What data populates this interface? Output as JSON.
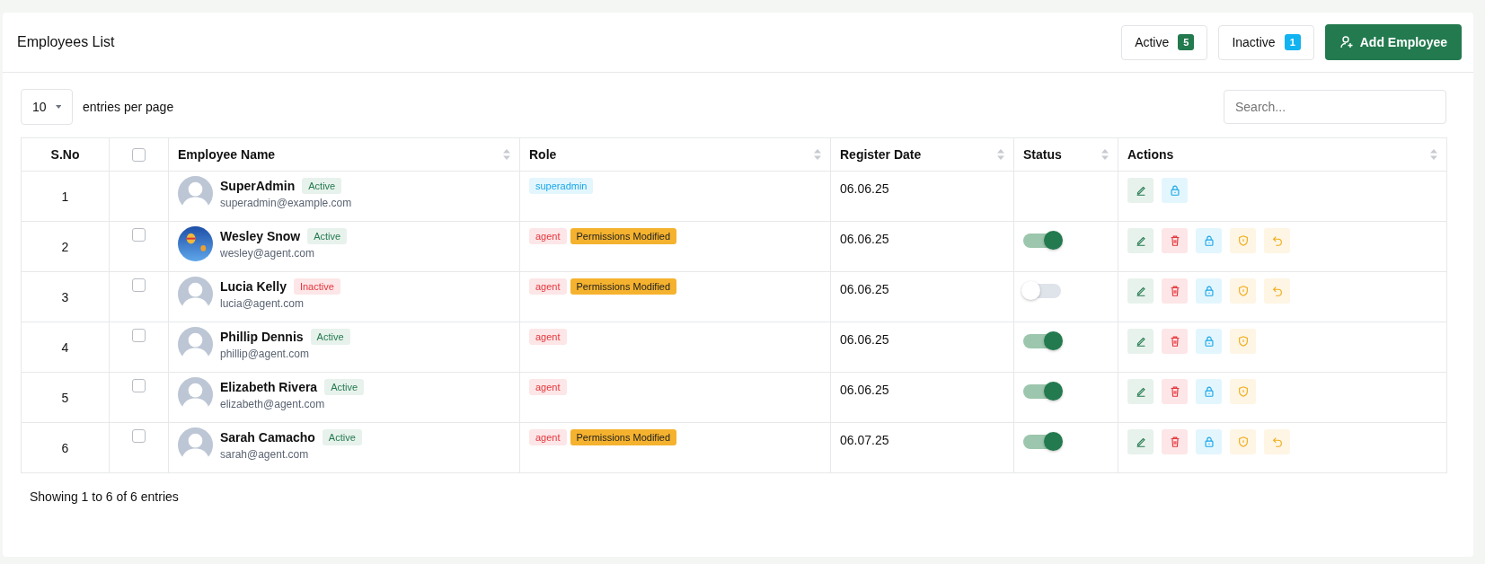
{
  "header": {
    "title": "Employees List",
    "filters": [
      {
        "label": "Active",
        "count": "5",
        "kind": "active"
      },
      {
        "label": "Inactive",
        "count": "1",
        "kind": "inactive"
      }
    ],
    "add_button": {
      "label": "Add Employee"
    }
  },
  "page_size": {
    "value": "10",
    "label": "entries per page"
  },
  "search": {
    "placeholder": "Search..."
  },
  "table": {
    "select_all": {
      "checked": false
    },
    "columns": [
      {
        "label": "S.No",
        "kind": "sno",
        "sortable": false
      },
      {
        "kind": "check",
        "sortable": false
      },
      {
        "label": "Employee Name",
        "kind": "name",
        "sortable": true
      },
      {
        "label": "Role",
        "kind": "role",
        "sortable": true
      },
      {
        "label": "Register Date",
        "kind": "date",
        "sortable": true
      },
      {
        "label": "Status",
        "kind": "status",
        "sortable": true
      },
      {
        "label": "Actions",
        "kind": "actions",
        "sortable": true
      }
    ],
    "rows": [
      {
        "sno": "1",
        "avatar": {
          "kind": "default"
        },
        "name": "SuperAdmin",
        "badge": {
          "label": "Active",
          "kind": "active"
        },
        "email": "superadmin@example.com",
        "roles": [
          {
            "label": "superadmin",
            "kind": "superadmin"
          }
        ],
        "date": "06.06.25",
        "actions": [
          {
            "kind": "edit"
          },
          {
            "kind": "lock"
          }
        ]
      },
      {
        "sno": "2",
        "checkbox": {
          "checked": false
        },
        "avatar": {
          "kind": "photo"
        },
        "name": "Wesley Snow",
        "badge": {
          "label": "Active",
          "kind": "active"
        },
        "email": "wesley@agent.com",
        "roles": [
          {
            "label": "agent",
            "kind": "agent"
          },
          {
            "label": "Permissions Modified",
            "kind": "modified"
          }
        ],
        "date": "06.06.25",
        "toggle": {
          "on": true
        },
        "actions": [
          {
            "kind": "edit"
          },
          {
            "kind": "delete"
          },
          {
            "kind": "lock"
          },
          {
            "kind": "shield"
          },
          {
            "kind": "undo"
          }
        ]
      },
      {
        "sno": "3",
        "checkbox": {
          "checked": false
        },
        "avatar": {
          "kind": "default"
        },
        "name": "Lucia Kelly",
        "badge": {
          "label": "Inactive",
          "kind": "inactive"
        },
        "email": "lucia@agent.com",
        "roles": [
          {
            "label": "agent",
            "kind": "agent"
          },
          {
            "label": "Permissions Modified",
            "kind": "modified"
          }
        ],
        "date": "06.06.25",
        "toggle": {
          "on": false
        },
        "actions": [
          {
            "kind": "edit"
          },
          {
            "kind": "delete"
          },
          {
            "kind": "lock"
          },
          {
            "kind": "shield"
          },
          {
            "kind": "undo"
          }
        ]
      },
      {
        "sno": "4",
        "checkbox": {
          "checked": false
        },
        "avatar": {
          "kind": "default"
        },
        "name": "Phillip Dennis",
        "badge": {
          "label": "Active",
          "kind": "active"
        },
        "email": "phillip@agent.com",
        "roles": [
          {
            "label": "agent",
            "kind": "agent"
          }
        ],
        "date": "06.06.25",
        "toggle": {
          "on": true
        },
        "actions": [
          {
            "kind": "edit"
          },
          {
            "kind": "delete"
          },
          {
            "kind": "lock"
          },
          {
            "kind": "shield"
          }
        ]
      },
      {
        "sno": "5",
        "checkbox": {
          "checked": false
        },
        "avatar": {
          "kind": "default"
        },
        "name": "Elizabeth Rivera",
        "badge": {
          "label": "Active",
          "kind": "active"
        },
        "email": "elizabeth@agent.com",
        "roles": [
          {
            "label": "agent",
            "kind": "agent"
          }
        ],
        "date": "06.06.25",
        "toggle": {
          "on": true
        },
        "actions": [
          {
            "kind": "edit"
          },
          {
            "kind": "delete"
          },
          {
            "kind": "lock"
          },
          {
            "kind": "shield"
          }
        ]
      },
      {
        "sno": "6",
        "checkbox": {
          "checked": false
        },
        "avatar": {
          "kind": "default"
        },
        "name": "Sarah Camacho",
        "badge": {
          "label": "Active",
          "kind": "active"
        },
        "email": "sarah@agent.com",
        "roles": [
          {
            "label": "agent",
            "kind": "agent"
          },
          {
            "label": "Permissions Modified",
            "kind": "modified"
          }
        ],
        "date": "06.07.25",
        "toggle": {
          "on": true
        },
        "actions": [
          {
            "kind": "edit"
          },
          {
            "kind": "delete"
          },
          {
            "kind": "lock"
          },
          {
            "kind": "shield"
          },
          {
            "kind": "undo"
          }
        ]
      }
    ]
  },
  "footer": {
    "text": "Showing 1 to 6 of 6 entries"
  }
}
